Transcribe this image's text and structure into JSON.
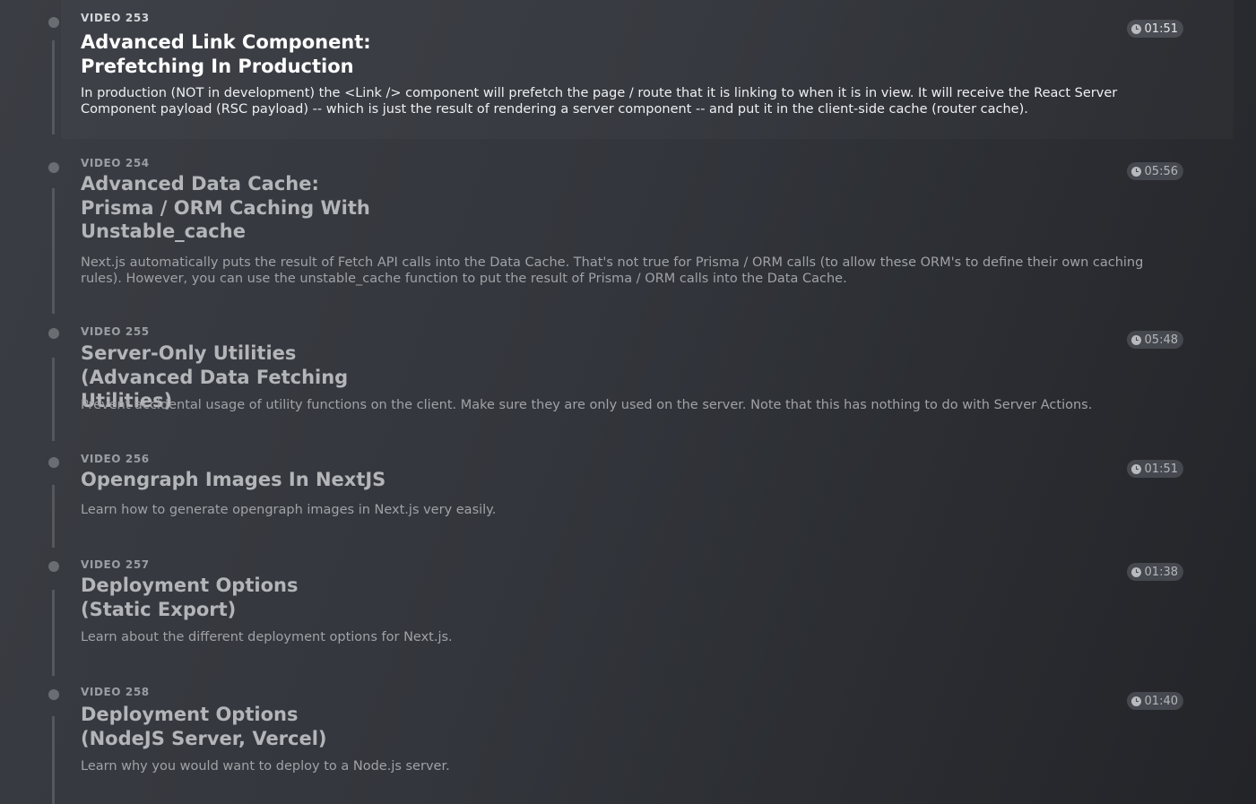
{
  "videos": [
    {
      "label": "VIDEO 253",
      "title": "Advanced Link Component: Prefetching In Production",
      "description": "In production (NOT in development) the <Link /> component will prefetch the page / route that it is linking to when it is in view. It will receive the React Server Component payload (RSC payload) -- which is just the result of rendering a server component -- and put it in the client-side cache (router cache).",
      "duration": "01:51",
      "active": true
    },
    {
      "label": "VIDEO 254",
      "title": "Advanced Data Cache: Prisma / ORM Caching With Unstable_cache",
      "description": "Next.js automatically puts the result of Fetch API calls into the Data Cache. That's not true for Prisma / ORM calls (to allow these ORM's to define their own caching rules). However, you can use the unstable_cache function to put the result of Prisma / ORM calls into the Data Cache.",
      "duration": "05:56",
      "active": false
    },
    {
      "label": "VIDEO 255",
      "title": "Server-Only Utilities (Advanced Data Fetching Utilities)",
      "description": "Prevent accidental usage of utility functions on the client. Make sure they are only used on the server. Note that this has nothing to do with Server Actions.",
      "duration": "05:48",
      "active": false
    },
    {
      "label": "VIDEO 256",
      "title": "Opengraph Images In NextJS",
      "description": "Learn how to generate opengraph images in Next.js very easily.",
      "duration": "01:51",
      "active": false
    },
    {
      "label": "VIDEO 257",
      "title": "Deployment Options (Static Export)",
      "description": "Learn about the different deployment options for Next.js.",
      "duration": "01:38",
      "active": false
    },
    {
      "label": "VIDEO 258",
      "title": "Deployment Options (NodeJS Server, Vercel)",
      "description": "Learn why you would want to deploy to a Node.js server.",
      "duration": "01:40",
      "active": false
    }
  ],
  "icons": {
    "duration": "clock-icon",
    "timeline": "timeline-dot-icon"
  }
}
